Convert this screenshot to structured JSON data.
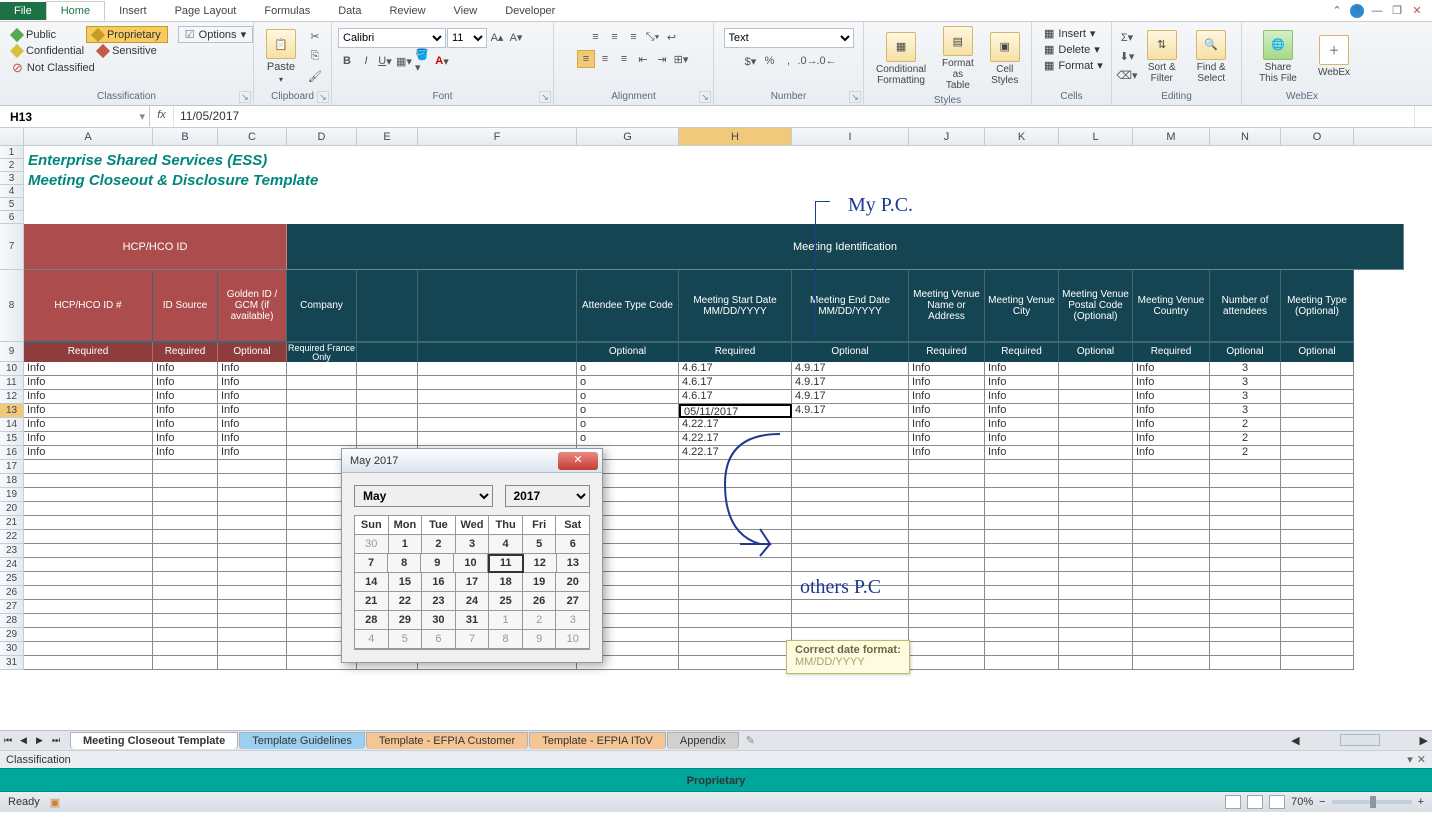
{
  "tabs": {
    "file": "File",
    "home": "Home",
    "insert": "Insert",
    "pagelayout": "Page Layout",
    "formulas": "Formulas",
    "data": "Data",
    "review": "Review",
    "view": "View",
    "developer": "Developer"
  },
  "ribbon": {
    "classification": {
      "public": "Public",
      "proprietary": "Proprietary",
      "confidential": "Confidential",
      "sensitive": "Sensitive",
      "notclassified": "Not Classified",
      "options": "Options",
      "label": "Classification"
    },
    "clipboard": {
      "paste": "Paste",
      "label": "Clipboard"
    },
    "font": {
      "name": "Calibri",
      "size": "11",
      "label": "Font"
    },
    "alignment": {
      "label": "Alignment"
    },
    "number": {
      "format": "Text",
      "label": "Number"
    },
    "styles": {
      "cond": "Conditional Formatting",
      "table": "Format as Table",
      "cell": "Cell Styles",
      "label": "Styles"
    },
    "cells": {
      "insert": "Insert",
      "delete": "Delete",
      "format": "Format",
      "label": "Cells"
    },
    "editing": {
      "sort": "Sort & Filter",
      "find": "Find & Select",
      "label": "Editing"
    },
    "share": {
      "share": "Share This File",
      "webex": "WebEx",
      "label": "WebEx"
    }
  },
  "namebox": "H13",
  "formula": "11/05/2017",
  "cols": [
    "A",
    "B",
    "C",
    "D",
    "E",
    "F",
    "G",
    "H",
    "I",
    "J",
    "K",
    "L",
    "M",
    "N",
    "O"
  ],
  "title1": "Enterprise Shared Services (ESS)",
  "title2": "Meeting Closeout & Disclosure Template",
  "section_hcp": "HCP/HCO ID",
  "section_meeting": "Meeting Identification",
  "headers": {
    "A": "HCP/HCO ID #",
    "B": "ID Source",
    "C": "Golden ID / GCM (if available)",
    "D": "Company",
    "G": "Attendee Type Code",
    "H": "Meeting Start Date MM/DD/YYYY",
    "I": "Meeting End Date MM/DD/YYYY",
    "J": "Meeting Venue Name or Address",
    "K": "Meeting Venue City",
    "L": "Meeting Venue Postal Code (Optional)",
    "M": "Meeting Venue Country",
    "N": "Number of attendees",
    "O": "Meeting Type (Optional)"
  },
  "req": {
    "A": "Required",
    "B": "Required",
    "C": "Optional",
    "D": "Required France Only",
    "G": "Optional",
    "H": "Required",
    "I": "Optional",
    "J": "Required",
    "K": "Required",
    "L": "Optional",
    "M": "Required",
    "N": "Optional",
    "O": "Optional"
  },
  "rows": [
    {
      "A": "Info",
      "B": "Info",
      "C": "Info",
      "G": "o",
      "H": "4.6.17",
      "I": "4.9.17",
      "J": "Info",
      "K": "Info",
      "M": "Info",
      "N": "3"
    },
    {
      "A": "Info",
      "B": "Info",
      "C": "Info",
      "G": "o",
      "H": "4.6.17",
      "I": "4.9.17",
      "J": "Info",
      "K": "Info",
      "M": "Info",
      "N": "3"
    },
    {
      "A": "Info",
      "B": "Info",
      "C": "Info",
      "G": "o",
      "H": "4.6.17",
      "I": "4.9.17",
      "J": "Info",
      "K": "Info",
      "M": "Info",
      "N": "3"
    },
    {
      "A": "Info",
      "B": "Info",
      "C": "Info",
      "G": "o",
      "H": "05/11/2017",
      "I": "4.9.17",
      "J": "Info",
      "K": "Info",
      "M": "Info",
      "N": "3"
    },
    {
      "A": "Info",
      "B": "Info",
      "C": "Info",
      "G": "o",
      "H": "4.22.17",
      "I": "",
      "J": "Info",
      "K": "Info",
      "M": "Info",
      "N": "2"
    },
    {
      "A": "Info",
      "B": "Info",
      "C": "Info",
      "G": "o",
      "H": "4.22.17",
      "I": "",
      "J": "Info",
      "K": "Info",
      "M": "Info",
      "N": "2"
    },
    {
      "A": "Info",
      "B": "Info",
      "C": "Info",
      "G": "o",
      "H": "4.22.17",
      "I": "",
      "J": "Info",
      "K": "Info",
      "M": "Info",
      "N": "2"
    }
  ],
  "rownums_short": [
    "1",
    "2",
    "3",
    "4",
    "5",
    "6"
  ],
  "rownums_data": [
    "10",
    "11",
    "12",
    "13",
    "14",
    "15",
    "16",
    "17",
    "18",
    "19",
    "20",
    "21",
    "22",
    "23",
    "24",
    "25",
    "26",
    "27",
    "28",
    "29",
    "30",
    "31"
  ],
  "datepicker": {
    "title": "May 2017",
    "month": "May",
    "year": "2017",
    "days": [
      "Sun",
      "Mon",
      "Tue",
      "Wed",
      "Thu",
      "Fri",
      "Sat"
    ],
    "grid": [
      [
        "30",
        "1",
        "2",
        "3",
        "4",
        "5",
        "6"
      ],
      [
        "7",
        "8",
        "9",
        "10",
        "11",
        "12",
        "13"
      ],
      [
        "14",
        "15",
        "16",
        "17",
        "18",
        "19",
        "20"
      ],
      [
        "21",
        "22",
        "23",
        "24",
        "25",
        "26",
        "27"
      ],
      [
        "28",
        "29",
        "30",
        "31",
        "1",
        "2",
        "3"
      ],
      [
        "4",
        "5",
        "6",
        "7",
        "8",
        "9",
        "10"
      ]
    ],
    "today": "11"
  },
  "tooltip": {
    "title": "Correct date format:",
    "body": "MM/DD/YYYY"
  },
  "ink": {
    "top": "My P.C.",
    "bottom": "others P.C"
  },
  "sheets": {
    "s1": "Meeting Closeout Template",
    "s2": "Template Guidelines",
    "s3": "Template - EFPIA Customer",
    "s4": "Template - EFPIA IToV",
    "s5": "Appendix"
  },
  "classbar": "Classification",
  "propbar": "Proprietary",
  "status": {
    "ready": "Ready",
    "zoom": "70%"
  }
}
